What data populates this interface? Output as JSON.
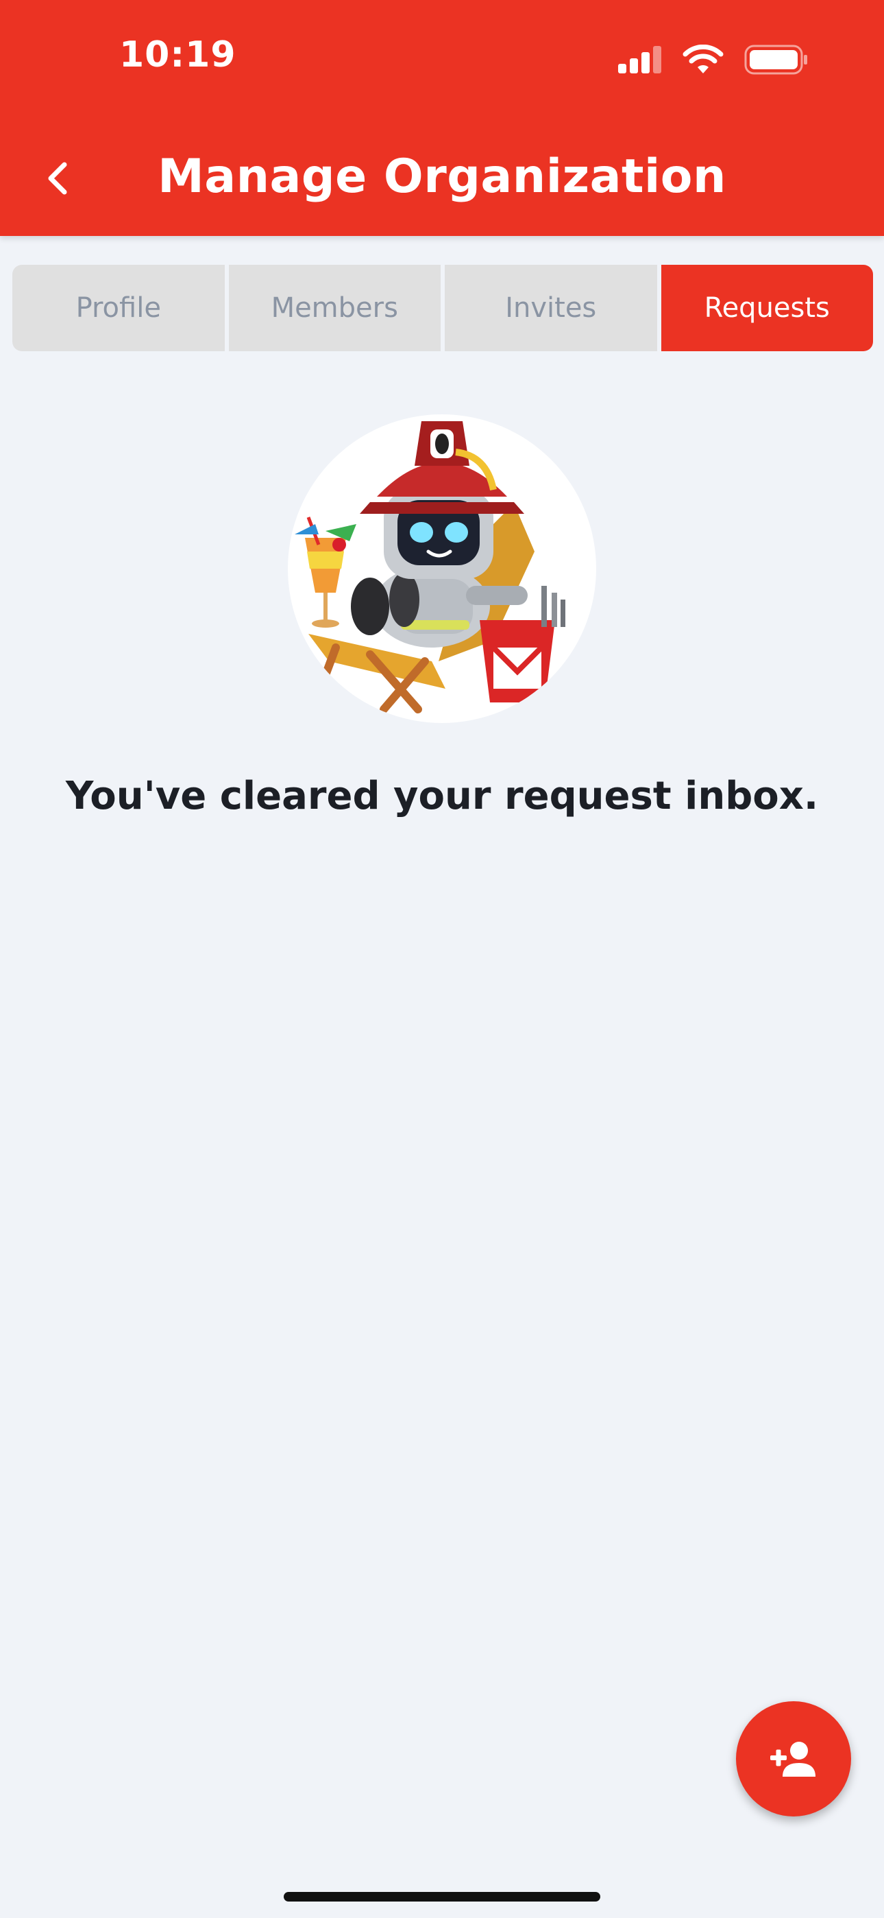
{
  "status_bar": {
    "time": "10:19"
  },
  "header": {
    "title": "Manage Organization",
    "back_icon": "chevron-left-icon"
  },
  "tabs": [
    {
      "label": "Profile",
      "active": false
    },
    {
      "label": "Members",
      "active": false
    },
    {
      "label": "Invites",
      "active": false
    },
    {
      "label": "Requests",
      "active": true
    }
  ],
  "empty_state": {
    "illustration": "robot-lounge-chair-illustration",
    "message": "You've cleared your request inbox."
  },
  "fab": {
    "icon": "add-person-icon"
  },
  "colors": {
    "brand": "#EB3323",
    "background": "#F0F3F8",
    "tab_inactive_bg": "#E0E0E0",
    "tab_inactive_text": "#8A94A3"
  }
}
